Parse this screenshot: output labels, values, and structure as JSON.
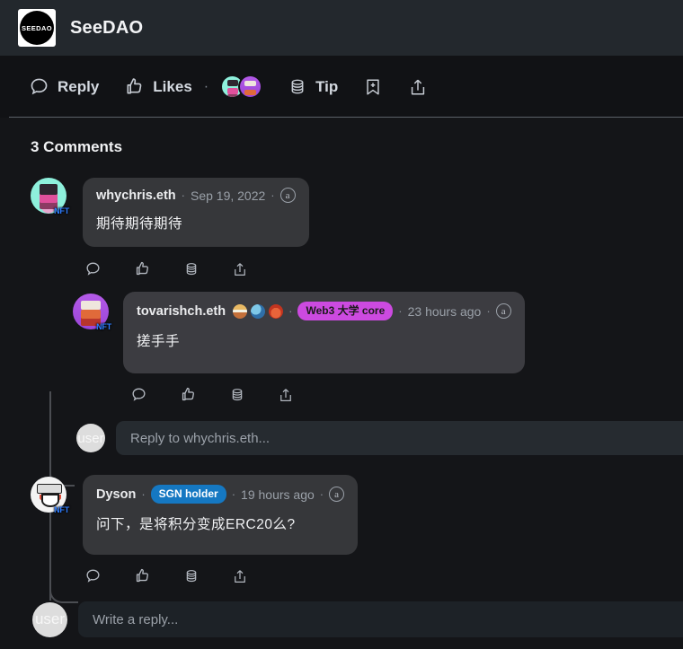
{
  "header": {
    "logo_text": "SEEDAO",
    "title": "SeeDAO"
  },
  "toolbar": {
    "reply_label": "Reply",
    "likes_label": "Likes",
    "likes_separator": "·",
    "tip_label": "Tip",
    "bookmark_icon": "bookmark-plus-icon",
    "share_icon": "share-upload-icon"
  },
  "main": {
    "comments_heading": "3 Comments",
    "comments": [
      {
        "author": "whychris.eth",
        "separator": "·",
        "time": "Sep 19, 2022",
        "badge_a": "a",
        "text": "期待期待期待",
        "avatar_style": "mint-pixel-nft",
        "nft_badge": "NFT"
      },
      {
        "author": "tovarishch.eth",
        "separator": "·",
        "tag": "Web3 大学 core",
        "tag_color": "#cc4ae0",
        "time": "23 hours ago",
        "badge_a": "a",
        "text": "搓手手",
        "avatar_style": "purple-pixel-nft",
        "nft_badge": "NFT",
        "emoji_badges": [
          "burger-emoji",
          "earth-emoji",
          "face-emoji"
        ]
      },
      {
        "author": "Dyson",
        "separator": "·",
        "tag": "SGN holder",
        "tag_color": "#1578c2",
        "time": "19 hours ago",
        "badge_a": "a",
        "text": "问下，是将积分变成ERC20么?",
        "avatar_style": "white-meme-nft",
        "nft_badge": "NFT"
      }
    ],
    "action_icons": [
      "comment-icon",
      "thumbs-up-icon",
      "tip-coins-icon",
      "share-icon"
    ],
    "nested_reply_input": {
      "placeholder": "Reply to whychris.eth...",
      "value": "",
      "avatar_text": "user"
    },
    "bottom_reply_input": {
      "placeholder": "Write a reply...",
      "value": "",
      "avatar_text": "user"
    }
  }
}
